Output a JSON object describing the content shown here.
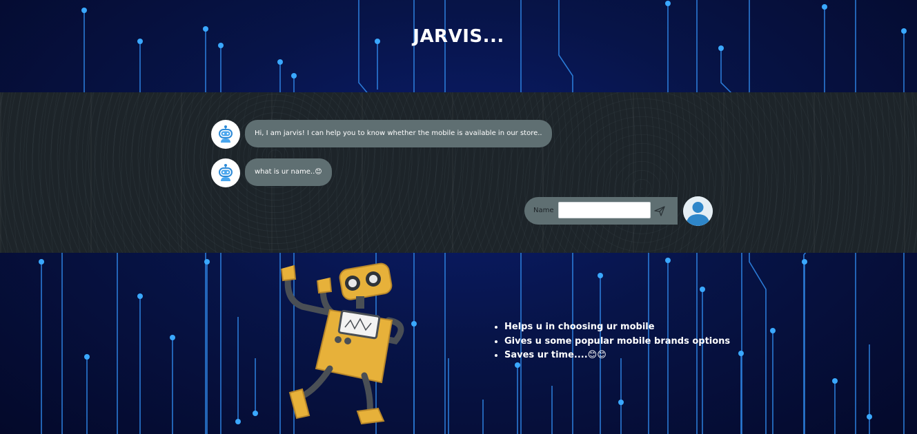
{
  "page": {
    "title": "JARVIS..."
  },
  "chat": {
    "bot_messages": [
      {
        "text": "Hi, I am jarvis! I can help you to know whether the mobile is available in our store.."
      },
      {
        "text": "what is ur name..😊"
      }
    ],
    "user_input": {
      "label": "Name",
      "value": "",
      "placeholder": ""
    }
  },
  "features": [
    "Helps u in choosing ur mobile",
    "Gives u some popular mobile brands options",
    "Saves ur time....😊😊"
  ],
  "icons": {
    "bot_avatar": "bot-avatar-icon",
    "user_avatar": "user-avatar-icon",
    "send": "send-icon",
    "robot": "robot-mascot"
  },
  "colors": {
    "bubble": "#5f6f72",
    "band": "#1d2429",
    "circuit": "#2f9bff",
    "robot_body": "#e7b13a"
  }
}
